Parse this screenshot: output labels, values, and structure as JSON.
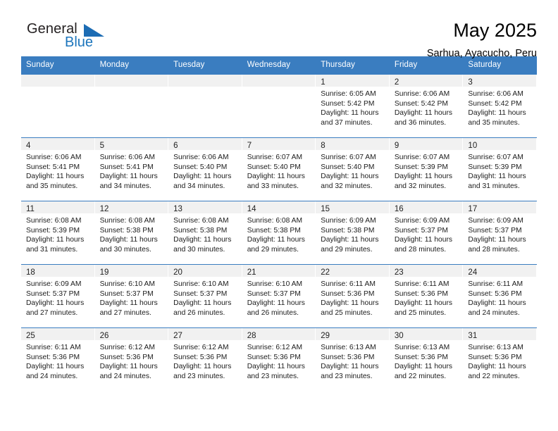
{
  "logo": {
    "word1": "General",
    "word2": "Blue",
    "triangle_color": "#1c6cb4",
    "blue_color": "#1c75bc"
  },
  "header": {
    "title": "May 2025",
    "location": "Sarhua, Ayacucho, Peru"
  },
  "theme": {
    "header_blue": "#3a7dc0",
    "daynum_band": "#f1f1f1",
    "text": "#1c1c1c"
  },
  "weekdays": [
    "Sunday",
    "Monday",
    "Tuesday",
    "Wednesday",
    "Thursday",
    "Friday",
    "Saturday"
  ],
  "weeks": [
    [
      {
        "day": "",
        "sunrise": "",
        "sunset": "",
        "daylight1": "",
        "daylight2": ""
      },
      {
        "day": "",
        "sunrise": "",
        "sunset": "",
        "daylight1": "",
        "daylight2": ""
      },
      {
        "day": "",
        "sunrise": "",
        "sunset": "",
        "daylight1": "",
        "daylight2": ""
      },
      {
        "day": "",
        "sunrise": "",
        "sunset": "",
        "daylight1": "",
        "daylight2": ""
      },
      {
        "day": "1",
        "sunrise": "Sunrise: 6:05 AM",
        "sunset": "Sunset: 5:42 PM",
        "daylight1": "Daylight: 11 hours",
        "daylight2": "and 37 minutes."
      },
      {
        "day": "2",
        "sunrise": "Sunrise: 6:06 AM",
        "sunset": "Sunset: 5:42 PM",
        "daylight1": "Daylight: 11 hours",
        "daylight2": "and 36 minutes."
      },
      {
        "day": "3",
        "sunrise": "Sunrise: 6:06 AM",
        "sunset": "Sunset: 5:42 PM",
        "daylight1": "Daylight: 11 hours",
        "daylight2": "and 35 minutes."
      }
    ],
    [
      {
        "day": "4",
        "sunrise": "Sunrise: 6:06 AM",
        "sunset": "Sunset: 5:41 PM",
        "daylight1": "Daylight: 11 hours",
        "daylight2": "and 35 minutes."
      },
      {
        "day": "5",
        "sunrise": "Sunrise: 6:06 AM",
        "sunset": "Sunset: 5:41 PM",
        "daylight1": "Daylight: 11 hours",
        "daylight2": "and 34 minutes."
      },
      {
        "day": "6",
        "sunrise": "Sunrise: 6:06 AM",
        "sunset": "Sunset: 5:40 PM",
        "daylight1": "Daylight: 11 hours",
        "daylight2": "and 34 minutes."
      },
      {
        "day": "7",
        "sunrise": "Sunrise: 6:07 AM",
        "sunset": "Sunset: 5:40 PM",
        "daylight1": "Daylight: 11 hours",
        "daylight2": "and 33 minutes."
      },
      {
        "day": "8",
        "sunrise": "Sunrise: 6:07 AM",
        "sunset": "Sunset: 5:40 PM",
        "daylight1": "Daylight: 11 hours",
        "daylight2": "and 32 minutes."
      },
      {
        "day": "9",
        "sunrise": "Sunrise: 6:07 AM",
        "sunset": "Sunset: 5:39 PM",
        "daylight1": "Daylight: 11 hours",
        "daylight2": "and 32 minutes."
      },
      {
        "day": "10",
        "sunrise": "Sunrise: 6:07 AM",
        "sunset": "Sunset: 5:39 PM",
        "daylight1": "Daylight: 11 hours",
        "daylight2": "and 31 minutes."
      }
    ],
    [
      {
        "day": "11",
        "sunrise": "Sunrise: 6:08 AM",
        "sunset": "Sunset: 5:39 PM",
        "daylight1": "Daylight: 11 hours",
        "daylight2": "and 31 minutes."
      },
      {
        "day": "12",
        "sunrise": "Sunrise: 6:08 AM",
        "sunset": "Sunset: 5:38 PM",
        "daylight1": "Daylight: 11 hours",
        "daylight2": "and 30 minutes."
      },
      {
        "day": "13",
        "sunrise": "Sunrise: 6:08 AM",
        "sunset": "Sunset: 5:38 PM",
        "daylight1": "Daylight: 11 hours",
        "daylight2": "and 30 minutes."
      },
      {
        "day": "14",
        "sunrise": "Sunrise: 6:08 AM",
        "sunset": "Sunset: 5:38 PM",
        "daylight1": "Daylight: 11 hours",
        "daylight2": "and 29 minutes."
      },
      {
        "day": "15",
        "sunrise": "Sunrise: 6:09 AM",
        "sunset": "Sunset: 5:38 PM",
        "daylight1": "Daylight: 11 hours",
        "daylight2": "and 29 minutes."
      },
      {
        "day": "16",
        "sunrise": "Sunrise: 6:09 AM",
        "sunset": "Sunset: 5:37 PM",
        "daylight1": "Daylight: 11 hours",
        "daylight2": "and 28 minutes."
      },
      {
        "day": "17",
        "sunrise": "Sunrise: 6:09 AM",
        "sunset": "Sunset: 5:37 PM",
        "daylight1": "Daylight: 11 hours",
        "daylight2": "and 28 minutes."
      }
    ],
    [
      {
        "day": "18",
        "sunrise": "Sunrise: 6:09 AM",
        "sunset": "Sunset: 5:37 PM",
        "daylight1": "Daylight: 11 hours",
        "daylight2": "and 27 minutes."
      },
      {
        "day": "19",
        "sunrise": "Sunrise: 6:10 AM",
        "sunset": "Sunset: 5:37 PM",
        "daylight1": "Daylight: 11 hours",
        "daylight2": "and 27 minutes."
      },
      {
        "day": "20",
        "sunrise": "Sunrise: 6:10 AM",
        "sunset": "Sunset: 5:37 PM",
        "daylight1": "Daylight: 11 hours",
        "daylight2": "and 26 minutes."
      },
      {
        "day": "21",
        "sunrise": "Sunrise: 6:10 AM",
        "sunset": "Sunset: 5:37 PM",
        "daylight1": "Daylight: 11 hours",
        "daylight2": "and 26 minutes."
      },
      {
        "day": "22",
        "sunrise": "Sunrise: 6:11 AM",
        "sunset": "Sunset: 5:36 PM",
        "daylight1": "Daylight: 11 hours",
        "daylight2": "and 25 minutes."
      },
      {
        "day": "23",
        "sunrise": "Sunrise: 6:11 AM",
        "sunset": "Sunset: 5:36 PM",
        "daylight1": "Daylight: 11 hours",
        "daylight2": "and 25 minutes."
      },
      {
        "day": "24",
        "sunrise": "Sunrise: 6:11 AM",
        "sunset": "Sunset: 5:36 PM",
        "daylight1": "Daylight: 11 hours",
        "daylight2": "and 24 minutes."
      }
    ],
    [
      {
        "day": "25",
        "sunrise": "Sunrise: 6:11 AM",
        "sunset": "Sunset: 5:36 PM",
        "daylight1": "Daylight: 11 hours",
        "daylight2": "and 24 minutes."
      },
      {
        "day": "26",
        "sunrise": "Sunrise: 6:12 AM",
        "sunset": "Sunset: 5:36 PM",
        "daylight1": "Daylight: 11 hours",
        "daylight2": "and 24 minutes."
      },
      {
        "day": "27",
        "sunrise": "Sunrise: 6:12 AM",
        "sunset": "Sunset: 5:36 PM",
        "daylight1": "Daylight: 11 hours",
        "daylight2": "and 23 minutes."
      },
      {
        "day": "28",
        "sunrise": "Sunrise: 6:12 AM",
        "sunset": "Sunset: 5:36 PM",
        "daylight1": "Daylight: 11 hours",
        "daylight2": "and 23 minutes."
      },
      {
        "day": "29",
        "sunrise": "Sunrise: 6:13 AM",
        "sunset": "Sunset: 5:36 PM",
        "daylight1": "Daylight: 11 hours",
        "daylight2": "and 23 minutes."
      },
      {
        "day": "30",
        "sunrise": "Sunrise: 6:13 AM",
        "sunset": "Sunset: 5:36 PM",
        "daylight1": "Daylight: 11 hours",
        "daylight2": "and 22 minutes."
      },
      {
        "day": "31",
        "sunrise": "Sunrise: 6:13 AM",
        "sunset": "Sunset: 5:36 PM",
        "daylight1": "Daylight: 11 hours",
        "daylight2": "and 22 minutes."
      }
    ]
  ]
}
